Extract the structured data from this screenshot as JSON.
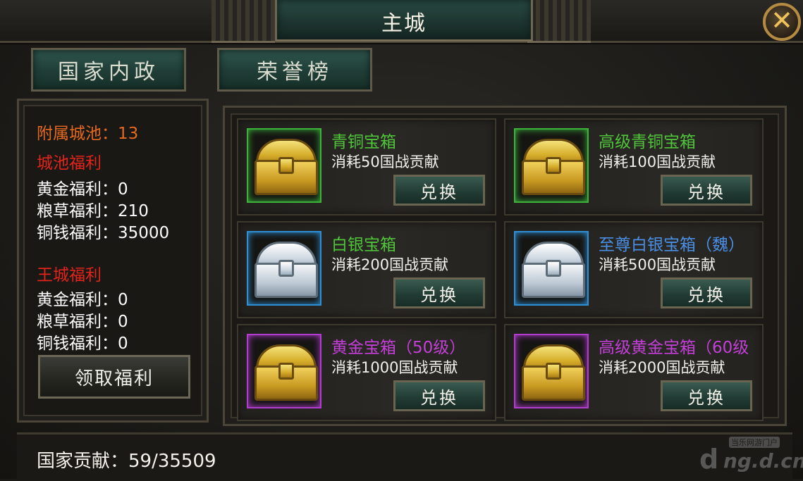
{
  "window": {
    "title": "主城"
  },
  "tabs": [
    {
      "label": "国家内政"
    },
    {
      "label": "荣誉榜"
    }
  ],
  "left_panel": {
    "attached_cities": "附属城池：13",
    "city_welfare_heading": "城池福利",
    "city_welfare": [
      "黄金福利：0",
      "粮草福利：210",
      "铜钱福利：35000"
    ],
    "royal_welfare_heading": "王城福利",
    "royal_welfare": [
      "黄金福利：0",
      "粮草福利：0",
      "铜钱福利：0"
    ],
    "claim_button": "领取福利"
  },
  "shop": {
    "exchange_label": "兑换",
    "items": [
      {
        "name": "青铜宝箱",
        "cost": "消耗50国战贡献",
        "name_color": "#4fc43a",
        "border_color": "#3cb33a",
        "chest": "gold"
      },
      {
        "name": "高级青铜宝箱",
        "cost": "消耗100国战贡献",
        "name_color": "#4fc43a",
        "border_color": "#3cb33a",
        "chest": "gold"
      },
      {
        "name": "白银宝箱",
        "cost": "消耗200国战贡献",
        "name_color": "#4fc43a",
        "border_color": "#2f8fd6",
        "chest": "silver"
      },
      {
        "name": "至尊白银宝箱（魏）",
        "cost": "消耗500国战贡献",
        "name_color": "#4a8fe6",
        "border_color": "#2f8fd6",
        "chest": "silver"
      },
      {
        "name": "黄金宝箱（50级）",
        "cost": "消耗1000国战贡献",
        "name_color": "#c33fd8",
        "border_color": "#b23bd0",
        "chest": "gold"
      },
      {
        "name": "高级黄金宝箱（60级",
        "cost": "消耗2000国战贡献",
        "name_color": "#c33fd8",
        "border_color": "#b23bd0",
        "chest": "gold"
      }
    ]
  },
  "footer": {
    "contribution": "国家贡献：59/35509",
    "watermark_top": "当乐网游门户",
    "watermark_main": "ng.d.cn",
    "watermark_letter": "d"
  }
}
